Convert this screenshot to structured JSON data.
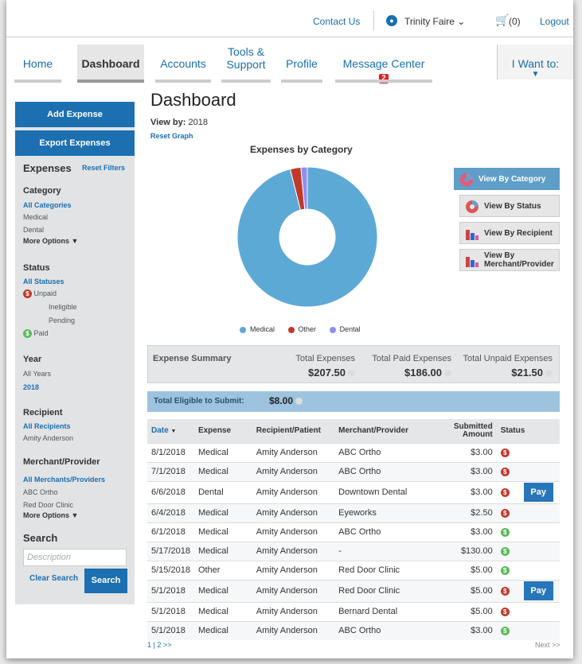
{
  "header": {
    "contact": "Contact Us",
    "user_name": "Trinity Faire",
    "user_caret": "⌄",
    "cart_count": "(0)",
    "logout": "Logout"
  },
  "nav": {
    "tabs": [
      {
        "label": "Home"
      },
      {
        "label": "Dashboard",
        "active": true
      },
      {
        "label": "Accounts"
      },
      {
        "label_line1": "Tools &",
        "label_line2": "Support"
      },
      {
        "label": "Profile"
      },
      {
        "label": "Message Center",
        "badge": "2"
      }
    ],
    "i_want": "I Want to:"
  },
  "sidebar": {
    "add_expense": "Add Expense",
    "export_expenses": "Export Expenses",
    "expenses_heading": "Expenses",
    "reset_filters": "Reset Filters",
    "category": {
      "title": "Category",
      "items": [
        "All Categories",
        "Medical",
        "Dental"
      ],
      "more": "More Options"
    },
    "status": {
      "title": "Status",
      "items": [
        "All Statuses",
        "Unpaid",
        "Ineligible",
        "Pending",
        "Paid"
      ]
    },
    "year": {
      "title": "Year",
      "items": [
        "All Years",
        "2018"
      ]
    },
    "recipient": {
      "title": "Recipient",
      "items": [
        "All Recipients",
        "Amity Anderson"
      ]
    },
    "merchant": {
      "title": "Merchant/Provider",
      "items": [
        "All Merchants/Providers",
        "ABC Ortho",
        "Red Door Clinic"
      ],
      "more": "More Options"
    },
    "search": {
      "title": "Search",
      "placeholder": "Description",
      "clear": "Clear Search",
      "button": "Search"
    }
  },
  "main": {
    "title": "Dashboard",
    "view_by_label": "View by:",
    "view_by_value": "2018",
    "reset_graph": "Reset Graph",
    "view_buttons": {
      "category": "View By Category",
      "status": "View By Status",
      "recipient": "View By Recipient",
      "merchant_l1": "View By",
      "merchant_l2": "Merchant/Provider"
    },
    "summary": {
      "label": "Expense Summary",
      "total_expenses_label": "Total Expenses",
      "total_expenses": "$207.50",
      "total_paid_label": "Total Paid Expenses",
      "total_paid": "$186.00",
      "total_unpaid_label": "Total Unpaid Expenses",
      "total_unpaid": "$21.50"
    },
    "eligible": {
      "label": "Total Eligible to Submit:",
      "value": "$8.00"
    },
    "table": {
      "headers": [
        "Date",
        "Expense",
        "Recipient/Patient",
        "Merchant/Provider",
        "Submitted",
        "Amount",
        "Status"
      ],
      "rows": [
        {
          "date": "8/1/2018",
          "expense": "Medical",
          "recipient": "Amity Anderson",
          "merchant": "ABC Ortho",
          "amount": "$3.00",
          "status": "unpaid"
        },
        {
          "date": "7/1/2018",
          "expense": "Medical",
          "recipient": "Amity Anderson",
          "merchant": "ABC Ortho",
          "amount": "$3.00",
          "status": "unpaid"
        },
        {
          "date": "6/6/2018",
          "expense": "Dental",
          "recipient": "Amity Anderson",
          "merchant": "Downtown Dental",
          "amount": "$3.00",
          "status": "unpaid",
          "pay": "Pay"
        },
        {
          "date": "6/4/2018",
          "expense": "Medical",
          "recipient": "Amity Anderson",
          "merchant": "Eyeworks",
          "amount": "$2.50",
          "status": "unpaid"
        },
        {
          "date": "6/1/2018",
          "expense": "Medical",
          "recipient": "Amity Anderson",
          "merchant": "ABC Ortho",
          "amount": "$3.00",
          "status": "paid"
        },
        {
          "date": "5/17/2018",
          "expense": "Medical",
          "recipient": "Amity Anderson",
          "merchant": "-",
          "amount": "$130.00",
          "status": "paid"
        },
        {
          "date": "5/15/2018",
          "expense": "Other",
          "recipient": "Amity Anderson",
          "merchant": "Red Door Clinic",
          "amount": "$5.00",
          "status": "paid"
        },
        {
          "date": "5/1/2018",
          "expense": "Medical",
          "recipient": "Amity Anderson",
          "merchant": "Red Door Clinic",
          "amount": "$5.00",
          "status": "unpaid",
          "pay": "Pay"
        },
        {
          "date": "5/1/2018",
          "expense": "Medical",
          "recipient": "Amity Anderson",
          "merchant": "Bernard Dental",
          "amount": "$5.00",
          "status": "unpaid"
        },
        {
          "date": "5/1/2018",
          "expense": "Medical",
          "recipient": "Amity Anderson",
          "merchant": "ABC Ortho",
          "amount": "$3.00",
          "status": "paid"
        }
      ]
    },
    "pager": "1 | 2 >>",
    "next": "Next >>"
  },
  "chart_data": {
    "type": "pie",
    "title": "Expenses by Category",
    "categories": [
      "Medical",
      "Other",
      "Dental"
    ],
    "values": [
      195.5,
      5.0,
      3.0
    ],
    "colors": [
      "#5da9d6",
      "#c0392b",
      "#8f8ff0"
    ],
    "legend": "bottom"
  },
  "colors": {
    "accent": "#1c6fb0",
    "unpaid": "#c0392b",
    "paid": "#5cb85c",
    "badge": "#e02020"
  }
}
